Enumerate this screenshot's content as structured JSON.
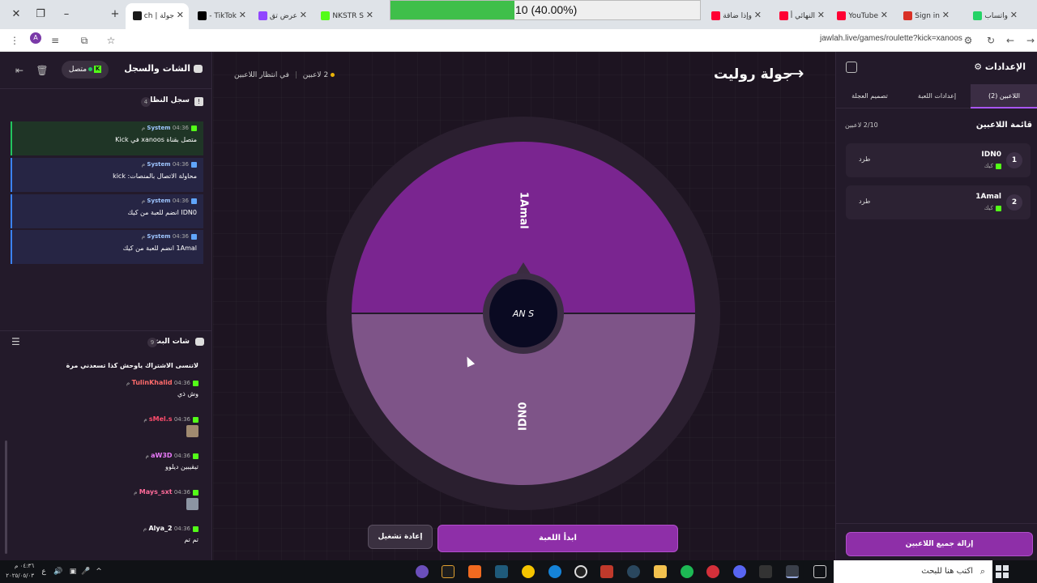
{
  "browser": {
    "tabs": [
      {
        "label": "جولة | ch",
        "active": true,
        "fav_color": "#1a1a1a"
      },
      {
        "label": "TikTok -",
        "fav_color": "#000000"
      },
      {
        "label": "عرض تق",
        "fav_color": "#9146ff"
      },
      {
        "label": "NKSTR S",
        "fav_color": "#53fc18"
      },
      {
        "label": "وإذا ضاقة",
        "fav_color": "#ff0033"
      },
      {
        "label": "النهائي أ",
        "fav_color": "#ff0033"
      },
      {
        "label": "YouTube",
        "fav_color": "#ff0033"
      },
      {
        "label": "Sign in",
        "fav_color": "#d93025"
      },
      {
        "label": "واتساب",
        "fav_color": "#25d366"
      }
    ],
    "new_tab": "+",
    "url": "jawlah.live/games/roulette?kick=xanoos",
    "profile_initial": "A"
  },
  "media_overlay": {
    "text": "10 (40.00%)",
    "progress_percent": 40
  },
  "chat_panel": {
    "title": "الشات والسجل",
    "status": "متصل",
    "system_log": {
      "title": "سجل النظام",
      "count": "4",
      "messages": [
        {
          "type": "ok",
          "sender": "System",
          "time": "04:36 م",
          "text": "متصل بقناة xanoos في Kick"
        },
        {
          "type": "info",
          "sender": "System",
          "time": "04:36 م",
          "text": "محاولة الاتصال بالمنصات: kick"
        },
        {
          "type": "info",
          "sender": "System",
          "time": "04:36 م",
          "text": "IDN0 انضم للعبة من كيك"
        },
        {
          "type": "info",
          "sender": "System",
          "time": "04:36 م",
          "text": "1Amal انضم للعبة من كيك"
        }
      ]
    },
    "live_chat": {
      "title": "شات البث",
      "count": "9",
      "messages": [
        {
          "user": "",
          "time": "",
          "text": "لاتنسى الاشتراك ياوحش كذا تسعدني مرة",
          "user_color": "#ffffff",
          "emote": false
        },
        {
          "user": "TulinKhalid",
          "time": "04:36 م",
          "text": "وش ذي",
          "user_color": "#ff6b6b",
          "emote": false
        },
        {
          "user": "sMel.s",
          "time": "04:36 م",
          "text": "",
          "user_color": "#ff4d6d",
          "emote": true
        },
        {
          "user": "aW3D",
          "time": "04:36 م",
          "text": "تيقيبين ديلوو",
          "user_color": "#e879f9",
          "emote": false
        },
        {
          "user": "Mays_sxt",
          "time": "04:36 م",
          "text": "",
          "user_color": "#ff6b9a",
          "emote": true
        },
        {
          "user": "Alya_2",
          "time": "04:36 م",
          "text": "تم تم",
          "user_color": "#ffffff",
          "emote": false
        }
      ]
    }
  },
  "game": {
    "title": "جولة روليت",
    "players_count": "2 لاعبين",
    "status": "في انتظار اللاعبين",
    "wheel": {
      "segments": [
        {
          "label": "1Amal",
          "color": "#7a2590"
        },
        {
          "label": "IDN0",
          "color": "#7e5488"
        }
      ],
      "center_logo": "AN  S"
    },
    "start_button": "ابدأ اللعبة",
    "reset_button": "إعادة تشغيل"
  },
  "settings": {
    "title": "الإعدادات",
    "tabs": [
      {
        "label": "اللاعبين (2)",
        "active": true
      },
      {
        "label": "إعدادات اللعبة",
        "active": false
      },
      {
        "label": "تصميم العجلة",
        "active": false
      }
    ],
    "players_heading": "قائمة اللاعبين",
    "players_capacity": "2/10 لاعبين",
    "players": [
      {
        "num": "1",
        "name": "IDN0",
        "platform": "كيك",
        "kick_label": "طرد"
      },
      {
        "num": "2",
        "name": "1Amal",
        "platform": "كيك",
        "kick_label": "طرد"
      }
    ],
    "remove_all": "إزالة جميع اللاعبين"
  },
  "taskbar": {
    "search_placeholder": "اكتب هنا للبحث",
    "time": "٠٤:٣٦ م",
    "date": "٢٠٢٥/٠٥/٠٣",
    "lang": "ع"
  }
}
